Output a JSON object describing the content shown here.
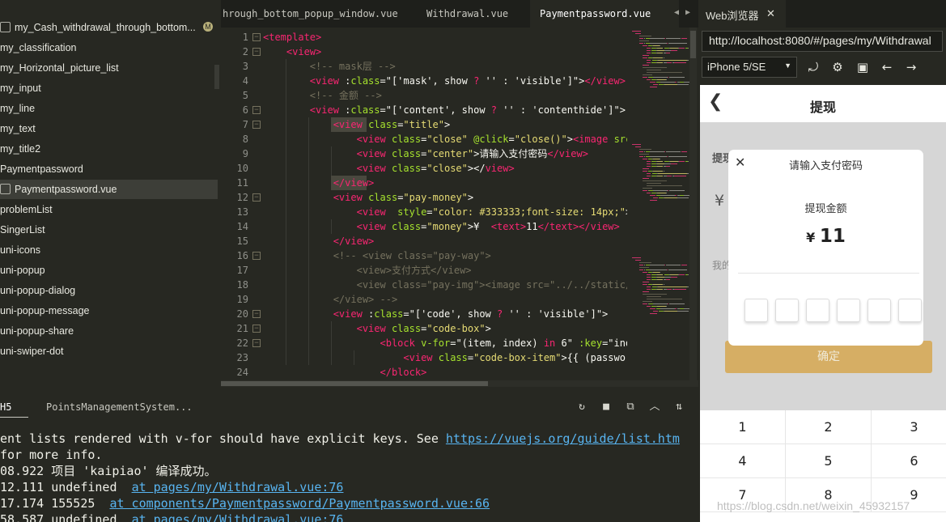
{
  "file_tree": {
    "items": [
      {
        "label": "my_Cash_withdrawal_through_bottom...",
        "icon": "file-icon",
        "modified_badge": "M"
      },
      {
        "label": "my_classification"
      },
      {
        "label": "my_Horizontal_picture_list"
      },
      {
        "label": "my_input"
      },
      {
        "label": "my_line"
      },
      {
        "label": "my_text"
      },
      {
        "label": "my_title2"
      },
      {
        "label": "Paymentpassword"
      },
      {
        "label": "Paymentpassword.vue",
        "icon": "file-icon",
        "selected": true
      },
      {
        "label": "problemList"
      },
      {
        "label": "SingerList"
      },
      {
        "label": "uni-icons"
      },
      {
        "label": "uni-popup"
      },
      {
        "label": "uni-popup-dialog"
      },
      {
        "label": "uni-popup-message"
      },
      {
        "label": "uni-popup-share"
      },
      {
        "label": "uni-swiper-dot"
      }
    ]
  },
  "editor": {
    "tabs": [
      {
        "label": "hrough_bottom_popup_window.vue",
        "active": false
      },
      {
        "label": "Withdrawal.vue",
        "active": false
      },
      {
        "label": "Paymentpassword.vue",
        "active": true
      }
    ],
    "lines": [
      [
        [
          "tag",
          "<template>"
        ],
        [
          "plain",
          ""
        ]
      ],
      [
        [
          "plain",
          "    "
        ],
        [
          "tag",
          "<view>"
        ]
      ],
      [
        [
          "plain",
          "        "
        ],
        [
          "com",
          "<!-- mask层 -->"
        ]
      ],
      [
        [
          "plain",
          "        "
        ],
        [
          "tag",
          "<view"
        ],
        [
          "plain",
          " :"
        ],
        [
          "attr",
          "class"
        ],
        [
          "plain",
          "=\"['mask', show "
        ],
        [
          "op",
          "?"
        ],
        [
          "plain",
          " '' : 'visible']\">"
        ],
        [
          "tag",
          "</view>"
        ]
      ],
      [
        [
          "plain",
          "        "
        ],
        [
          "com",
          "<!-- 金额 -->"
        ]
      ],
      [
        [
          "plain",
          "        "
        ],
        [
          "tag",
          "<view"
        ],
        [
          "plain",
          " :"
        ],
        [
          "attr",
          "class"
        ],
        [
          "plain",
          "=\"['content', show "
        ],
        [
          "op",
          "?"
        ],
        [
          "plain",
          " '' : 'contenthide']\">"
        ]
      ],
      [
        [
          "plain",
          "            "
        ],
        [
          "tag",
          "<view"
        ],
        [
          "plain",
          " "
        ],
        [
          "attr",
          "class"
        ],
        [
          "plain",
          "="
        ],
        [
          "str",
          "\"title\""
        ],
        [
          "plain",
          ">"
        ]
      ],
      [
        [
          "plain",
          "                "
        ],
        [
          "tag",
          "<view"
        ],
        [
          "plain",
          " "
        ],
        [
          "attr",
          "class"
        ],
        [
          "plain",
          "="
        ],
        [
          "str",
          "\"close\""
        ],
        [
          "plain",
          " "
        ],
        [
          "attr",
          "@click"
        ],
        [
          "plain",
          "="
        ],
        [
          "str",
          "\"close()\""
        ],
        [
          "plain",
          ">"
        ],
        [
          "tag",
          "<image"
        ],
        [
          "plain",
          " "
        ],
        [
          "attr",
          "src"
        ],
        [
          "plain",
          "="
        ]
      ],
      [
        [
          "plain",
          "                "
        ],
        [
          "tag",
          "<view"
        ],
        [
          "plain",
          " "
        ],
        [
          "attr",
          "class"
        ],
        [
          "plain",
          "="
        ],
        [
          "str",
          "\"center\""
        ],
        [
          "plain",
          ">请输入支付密码"
        ],
        [
          "tag",
          "</view>"
        ]
      ],
      [
        [
          "plain",
          "                "
        ],
        [
          "tag",
          "<view"
        ],
        [
          "plain",
          " "
        ],
        [
          "attr",
          "class"
        ],
        [
          "plain",
          "="
        ],
        [
          "str",
          "\"close\""
        ],
        [
          "plain",
          "></"
        ],
        [
          "tag",
          "view>"
        ]
      ],
      [
        [
          "plain",
          "            "
        ],
        [
          "tag",
          "</view>"
        ]
      ],
      [
        [
          "plain",
          "            "
        ],
        [
          "tag",
          "<view"
        ],
        [
          "plain",
          " "
        ],
        [
          "attr",
          "class"
        ],
        [
          "plain",
          "="
        ],
        [
          "str",
          "\"pay-money\""
        ],
        [
          "plain",
          ">"
        ]
      ],
      [
        [
          "plain",
          "                "
        ],
        [
          "tag",
          "<view"
        ],
        [
          "plain",
          "  "
        ],
        [
          "attr",
          "style"
        ],
        [
          "plain",
          "="
        ],
        [
          "str",
          "\"color: #333333;font-size: 14px;\""
        ],
        [
          "plain",
          ">提"
        ]
      ],
      [
        [
          "plain",
          "                "
        ],
        [
          "tag",
          "<view"
        ],
        [
          "plain",
          " "
        ],
        [
          "attr",
          "class"
        ],
        [
          "plain",
          "="
        ],
        [
          "str",
          "\"money\""
        ],
        [
          "plain",
          ">¥  "
        ],
        [
          "tag",
          "<text>"
        ],
        [
          "plain",
          "11"
        ],
        [
          "tag",
          "</text></view>"
        ]
      ],
      [
        [
          "plain",
          "            "
        ],
        [
          "tag",
          "</view>"
        ]
      ],
      [
        [
          "plain",
          "            "
        ],
        [
          "com",
          "<!-- <view class=\"pay-way\">"
        ]
      ],
      [
        [
          "plain",
          "                "
        ],
        [
          "com",
          "<view>支付方式</view>"
        ]
      ],
      [
        [
          "plain",
          "                "
        ],
        [
          "com",
          "<view class=\"pay-img\"><image src=\"../../static/yu"
        ]
      ],
      [
        [
          "plain",
          "            "
        ],
        [
          "com",
          "</view> -->"
        ]
      ],
      [
        [
          "plain",
          "            "
        ],
        [
          "tag",
          "<view"
        ],
        [
          "plain",
          " :"
        ],
        [
          "attr",
          "class"
        ],
        [
          "plain",
          "=\"['code', show "
        ],
        [
          "op",
          "?"
        ],
        [
          "plain",
          " '' : 'visible']\">"
        ]
      ],
      [
        [
          "plain",
          "                "
        ],
        [
          "tag",
          "<view"
        ],
        [
          "plain",
          " "
        ],
        [
          "attr",
          "class"
        ],
        [
          "plain",
          "="
        ],
        [
          "str",
          "\"code-box\""
        ],
        [
          "plain",
          ">"
        ]
      ],
      [
        [
          "plain",
          "                    "
        ],
        [
          "tag",
          "<block"
        ],
        [
          "plain",
          " "
        ],
        [
          "attr",
          "v-for"
        ],
        [
          "plain",
          "=\"(item, index) "
        ],
        [
          "op",
          "in"
        ],
        [
          "plain",
          " 6\" "
        ],
        [
          "attr",
          ":key"
        ],
        [
          "plain",
          "=\"index"
        ]
      ],
      [
        [
          "plain",
          "                        "
        ],
        [
          "tag",
          "<view"
        ],
        [
          "plain",
          " "
        ],
        [
          "attr",
          "class"
        ],
        [
          "plain",
          "="
        ],
        [
          "str",
          "\"code-box-item\""
        ],
        [
          "plain",
          ">{{ (password"
        ]
      ],
      [
        [
          "plain",
          "                    "
        ],
        [
          "tag",
          "</block>"
        ]
      ]
    ]
  },
  "console": {
    "tabs": [
      {
        "label": "H5",
        "active": true
      },
      {
        "label": "PointsManagementSystem...",
        "active": false
      }
    ],
    "lines": [
      {
        "text": "ent lists rendered with v-for should have explicit keys. See ",
        "link": "https://vuejs.org/guide/list.htm"
      },
      {
        "text": "for more info.",
        "link": ""
      },
      {
        "text": "08.922 项目 'kaipiao' 编译成功。",
        "link": ""
      },
      {
        "text": "12.111 undefined  ",
        "link": "at pages/my/Withdrawal.vue:76"
      },
      {
        "text": "17.174 155525  ",
        "link": "at components/Paymentpassword/Paymentpassword.vue:66"
      },
      {
        "text": "58.587 undefined  ",
        "link": "at pages/my/Withdrawal.vue:76"
      }
    ]
  },
  "browser": {
    "tab_label": "Web浏览器",
    "tab_close": "✕",
    "url": "http://localhost:8080/#/pages/my/Withdrawal",
    "device": "iPhone 5/SE",
    "toolbar_icons": [
      "rotate-icon",
      "settings-icon",
      "console-icon",
      "back-arrow-icon",
      "forward-arrow-icon"
    ]
  },
  "phone": {
    "nav_title": "提现",
    "back_glyph": "❮",
    "bg_label1": "提现",
    "bg_yen": "¥",
    "bg_label2": "我的",
    "confirm_label": "确定",
    "modal": {
      "close_glyph": "✕",
      "title": "请输入支付密码",
      "pay_label": "提现金额",
      "currency": "¥",
      "amount": "11",
      "code_boxes": 6
    },
    "keypad": [
      "1",
      "2",
      "3",
      "4",
      "5",
      "6",
      "7",
      "8",
      "9"
    ]
  },
  "watermark": "https://blog.csdn.net/weixin_45932157",
  "colors": {
    "editor_bg": "#272822",
    "tag": "#f92672",
    "attr": "#a6e22e",
    "string": "#e6db74",
    "comment": "#75715e",
    "link": "#58b4f0",
    "confirm_button": "#d6ae64"
  }
}
